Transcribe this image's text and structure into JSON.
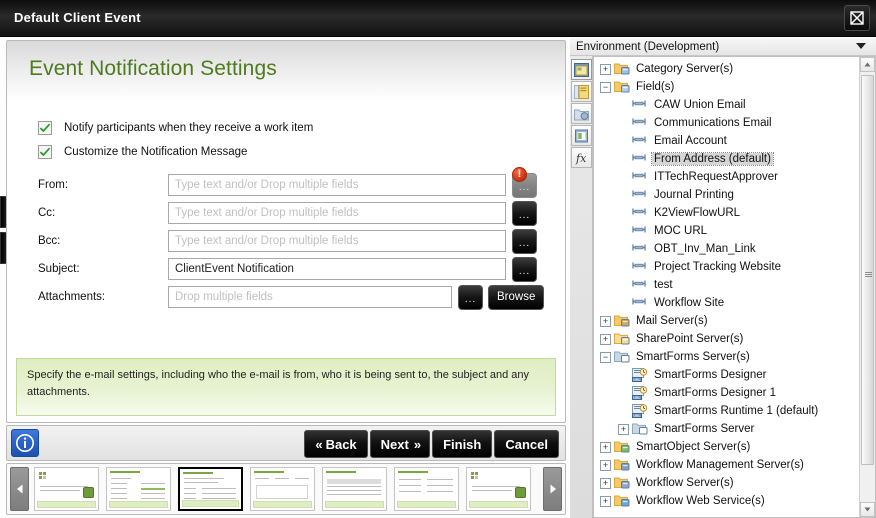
{
  "window": {
    "title": "Default Client Event",
    "close_label": "Close"
  },
  "wizard": {
    "title": "Event Notification Settings",
    "checkboxes": [
      {
        "label": "Notify participants when they receive a work item",
        "checked": true
      },
      {
        "label": "Customize the Notification Message",
        "checked": true
      }
    ],
    "fields": [
      {
        "label": "From:",
        "value": "",
        "placeholder": "Type text and/or Drop multiple fields",
        "has_error": true,
        "ellipsis_disabled": true
      },
      {
        "label": "Cc:",
        "value": "",
        "placeholder": "Type text and/or Drop multiple fields",
        "has_error": false,
        "ellipsis_disabled": false
      },
      {
        "label": "Bcc:",
        "value": "",
        "placeholder": "Type text and/or Drop multiple fields",
        "has_error": false,
        "ellipsis_disabled": false
      },
      {
        "label": "Subject:",
        "value": "ClientEvent Notification",
        "placeholder": "",
        "has_error": false,
        "ellipsis_disabled": false
      },
      {
        "label": "Attachments:",
        "value": "",
        "placeholder": "Drop multiple fields",
        "has_error": false,
        "ellipsis_disabled": false
      }
    ],
    "ellipsis_label": "...",
    "browse_label": "Browse",
    "error_badge": "!",
    "help_text": "Specify the e-mail settings, including who the e-mail is from, who it is being sent to, the subject and any attachments."
  },
  "buttonbar": {
    "info_label": "i",
    "buttons": [
      {
        "name": "back",
        "label": "Back",
        "chevron": "«",
        "chevron_side": "left"
      },
      {
        "name": "next",
        "label": "Next",
        "chevron": "»",
        "chevron_side": "right"
      },
      {
        "name": "finish",
        "label": "Finish",
        "chevron": "",
        "chevron_side": ""
      },
      {
        "name": "cancel",
        "label": "Cancel",
        "chevron": "",
        "chevron_side": ""
      }
    ]
  },
  "thumbstrip": {
    "prev_label": "◀",
    "next_label": "▶",
    "selected_index": 2,
    "thumbs": [
      {
        "kind": "logo"
      },
      {
        "kind": "form"
      },
      {
        "kind": "form"
      },
      {
        "kind": "panel"
      },
      {
        "kind": "table"
      },
      {
        "kind": "form"
      },
      {
        "kind": "logo"
      }
    ]
  },
  "environment": {
    "title": "Environment (Development)",
    "rail_icons": [
      "environment-library-icon",
      "workflow-context-icon",
      "object-browser-icon",
      "deployment-icon",
      "functions-icon"
    ],
    "tree": [
      {
        "label": "Category Server(s)",
        "depth": 0,
        "expander": "+",
        "icon": "folder-server",
        "selected": false
      },
      {
        "label": "Field(s)",
        "depth": 0,
        "expander": "-",
        "icon": "folder-field",
        "selected": false
      },
      {
        "label": "CAW Union Email",
        "depth": 1,
        "expander": "",
        "icon": "field",
        "selected": false
      },
      {
        "label": "Communications Email",
        "depth": 1,
        "expander": "",
        "icon": "field",
        "selected": false
      },
      {
        "label": "Email Account",
        "depth": 1,
        "expander": "",
        "icon": "field",
        "selected": false
      },
      {
        "label": "From Address (default)",
        "depth": 1,
        "expander": "",
        "icon": "field",
        "selected": true
      },
      {
        "label": "ITTechRequestApprover",
        "depth": 1,
        "expander": "",
        "icon": "field",
        "selected": false
      },
      {
        "label": "Journal Printing",
        "depth": 1,
        "expander": "",
        "icon": "field",
        "selected": false
      },
      {
        "label": "K2ViewFlowURL",
        "depth": 1,
        "expander": "",
        "icon": "field",
        "selected": false
      },
      {
        "label": "MOC URL",
        "depth": 1,
        "expander": "",
        "icon": "field",
        "selected": false
      },
      {
        "label": "OBT_Inv_Man_Link",
        "depth": 1,
        "expander": "",
        "icon": "field",
        "selected": false
      },
      {
        "label": "Project Tracking Website",
        "depth": 1,
        "expander": "",
        "icon": "field",
        "selected": false
      },
      {
        "label": "test",
        "depth": 1,
        "expander": "",
        "icon": "field",
        "selected": false
      },
      {
        "label": "Workflow Site",
        "depth": 1,
        "expander": "",
        "icon": "field",
        "selected": false
      },
      {
        "label": "Mail Server(s)",
        "depth": 0,
        "expander": "+",
        "icon": "folder-mail",
        "selected": false
      },
      {
        "label": "SharePoint Server(s)",
        "depth": 0,
        "expander": "+",
        "icon": "folder-sp",
        "selected": false
      },
      {
        "label": "SmartForms Server(s)",
        "depth": 0,
        "expander": "-",
        "icon": "folder-forms",
        "selected": false
      },
      {
        "label": "SmartForms Designer",
        "depth": 1,
        "expander": "",
        "icon": "url",
        "selected": false
      },
      {
        "label": "SmartForms Designer 1",
        "depth": 1,
        "expander": "",
        "icon": "url",
        "selected": false
      },
      {
        "label": "SmartForms Runtime 1 (default)",
        "depth": 1,
        "expander": "",
        "icon": "url",
        "selected": false
      },
      {
        "label": "SmartForms Server",
        "depth": 1,
        "expander": "+",
        "icon": "folder-forms",
        "selected": false
      },
      {
        "label": "SmartObject Server(s)",
        "depth": 0,
        "expander": "+",
        "icon": "folder-so",
        "selected": false
      },
      {
        "label": "Workflow Management Server(s)",
        "depth": 0,
        "expander": "+",
        "icon": "folder-wm",
        "selected": false
      },
      {
        "label": "Workflow Server(s)",
        "depth": 0,
        "expander": "+",
        "icon": "folder-wf",
        "selected": false
      },
      {
        "label": "Workflow Web Service(s)",
        "depth": 0,
        "expander": "+",
        "icon": "folder-ws",
        "selected": false
      }
    ],
    "scroll_up": "▲",
    "scroll_down": "▼"
  },
  "colors": {
    "accent_green": "#4d7b1e",
    "help_bg": "#dfeec2",
    "error_red": "#d93b13",
    "info_blue": "#2a62c6",
    "selection_gray": "#d6d6d6"
  }
}
